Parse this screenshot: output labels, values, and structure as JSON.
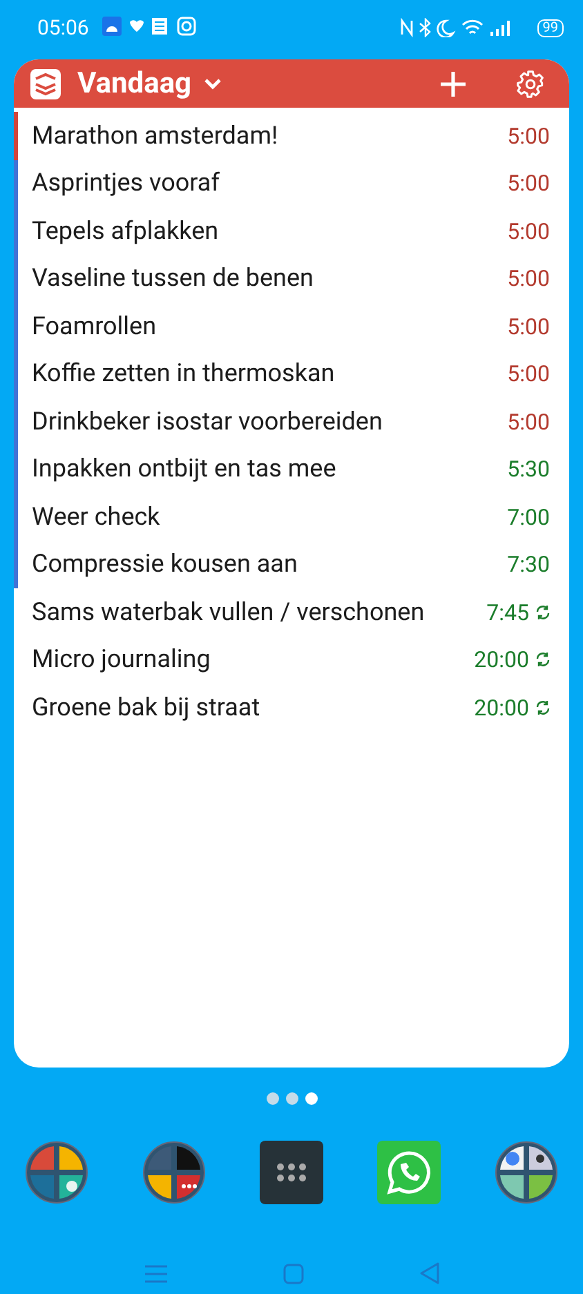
{
  "status_bar": {
    "time": "05:06",
    "battery": "99"
  },
  "widget": {
    "title": "Vandaag",
    "tasks": [
      {
        "title": "Marathon amsterdam!",
        "time": "5:00",
        "overdue": true,
        "recurring": false,
        "color": "#d1453b"
      },
      {
        "title": "Asprintjes vooraf",
        "time": "5:00",
        "overdue": true,
        "recurring": false,
        "color": "#4073d6"
      },
      {
        "title": "Tepels afplakken",
        "time": "5:00",
        "overdue": true,
        "recurring": false,
        "color": "#4073d6"
      },
      {
        "title": "Vaseline tussen de benen",
        "time": "5:00",
        "overdue": true,
        "recurring": false,
        "color": "#4073d6"
      },
      {
        "title": "Foamrollen",
        "time": "5:00",
        "overdue": true,
        "recurring": false,
        "color": "#4073d6"
      },
      {
        "title": "Koffie zetten in thermoskan",
        "time": "5:00",
        "overdue": true,
        "recurring": false,
        "color": "#4073d6"
      },
      {
        "title": "Drinkbeker isostar voorbereiden",
        "time": "5:00",
        "overdue": true,
        "recurring": false,
        "color": "#4073d6"
      },
      {
        "title": "Inpakken ontbijt en tas mee",
        "time": "5:30",
        "overdue": false,
        "recurring": false,
        "color": "#4073d6"
      },
      {
        "title": "Weer check",
        "time": "7:00",
        "overdue": false,
        "recurring": false,
        "color": "#4073d6"
      },
      {
        "title": "Compressie kousen aan",
        "time": "7:30",
        "overdue": false,
        "recurring": false,
        "color": "#4073d6"
      },
      {
        "title": "Sams waterbak vullen / verschonen",
        "time": "7:45",
        "overdue": false,
        "recurring": true
      },
      {
        "title": "Micro journaling",
        "time": "20:00",
        "overdue": false,
        "recurring": true
      },
      {
        "title": "Groene bak bij straat",
        "time": "20:00",
        "overdue": false,
        "recurring": true
      }
    ]
  },
  "page_dots": [
    {
      "selected": false
    },
    {
      "selected": false
    },
    {
      "selected": true
    }
  ],
  "dock": [
    {
      "kind": "folder"
    },
    {
      "kind": "folder2"
    },
    {
      "kind": "drawer"
    },
    {
      "kind": "chat"
    },
    {
      "kind": "folder3"
    }
  ]
}
